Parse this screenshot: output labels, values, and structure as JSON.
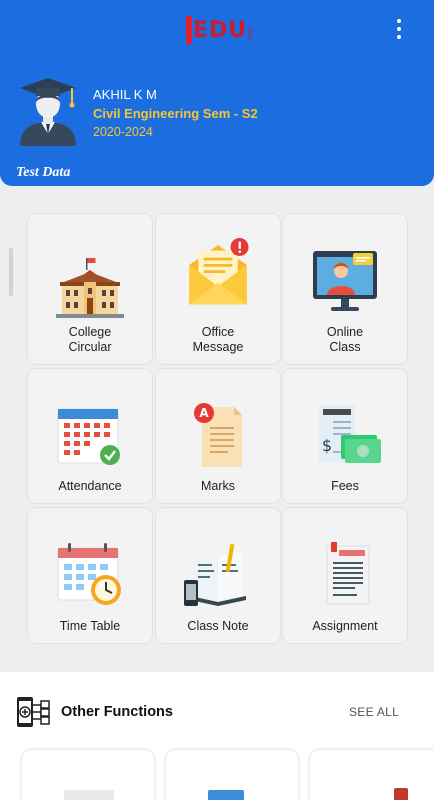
{
  "header": {
    "brand": "EDU",
    "brand_sub": "PRO",
    "menu_icon": "more-vert-icon",
    "bg_color": "#1c6ddf"
  },
  "profile": {
    "name": "AKHIL K M",
    "course": "Civil Engineering Sem - S2",
    "batch": "2020-2024",
    "tag": "Test Data",
    "accent_color": "#f5c634"
  },
  "tiles": [
    {
      "label_line1": "College",
      "label_line2": "Circular",
      "icon": "college-building-icon"
    },
    {
      "label_line1": "Office",
      "label_line2": "Message",
      "icon": "mail-envelope-icon"
    },
    {
      "label_line1": "Online",
      "label_line2": "Class",
      "icon": "online-class-icon"
    },
    {
      "label_line1": "Attendance",
      "label_line2": "",
      "icon": "calendar-check-icon"
    },
    {
      "label_line1": "Marks",
      "label_line2": "",
      "icon": "marks-paper-icon"
    },
    {
      "label_line1": "Fees",
      "label_line2": "",
      "icon": "fees-receipt-icon"
    },
    {
      "label_line1": "Time Table",
      "label_line2": "",
      "icon": "calendar-clock-icon"
    },
    {
      "label_line1": "Class Note",
      "label_line2": "",
      "icon": "notebook-icon"
    },
    {
      "label_line1": "Assignment",
      "label_line2": "",
      "icon": "assignment-document-icon"
    }
  ],
  "other_functions": {
    "title": "Other Functions",
    "see_all": "SEE ALL",
    "icon": "mobile-functions-icon"
  }
}
